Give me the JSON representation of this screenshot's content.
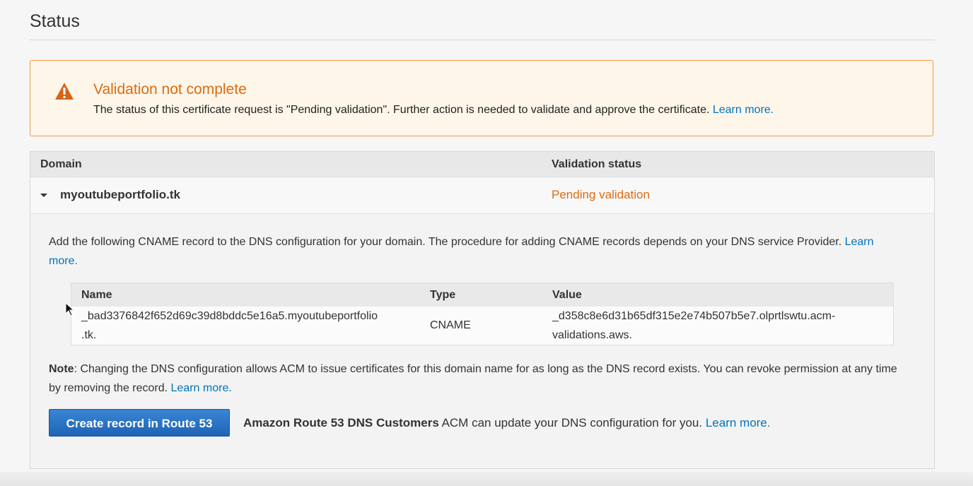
{
  "section": {
    "title": "Status"
  },
  "alert": {
    "icon": "warning-icon",
    "title": "Validation not complete",
    "body": "The status of this certificate request is \"Pending validation\". Further action is needed to validate and approve the certificate.",
    "link": "Learn more.",
    "accent_color": "#dd6b10"
  },
  "domains": {
    "headers": {
      "domain": "Domain",
      "status": "Validation status"
    },
    "row": {
      "domain": "myoutubeportfolio.tk",
      "status": "Pending validation"
    }
  },
  "instructions": {
    "text": "Add the following CNAME record to the DNS configuration for your domain. The procedure for adding CNAME records depends on your DNS service Provider.",
    "link": "Learn more."
  },
  "cname": {
    "headers": {
      "name": "Name",
      "type": "Type",
      "value": "Value"
    },
    "row": {
      "name_line1": "_bad3376842f652d69c39d8bddc5e16a5.myoutubeportfolio",
      "name_line2": ".tk.",
      "type": "CNAME",
      "value_line1": "_d358c8e6d31b65df315e2e74b507b5e7.olprtlswtu.acm-",
      "value_line2": "validations.aws."
    }
  },
  "note": {
    "label": "Note",
    "text": ": Changing the DNS configuration allows ACM to issue certificates for this domain name for as long as the DNS record exists. You can revoke permission at any time by removing the record.",
    "link": "Learn more."
  },
  "route53": {
    "button": "Create record in Route 53",
    "bold": "Amazon Route 53 DNS Customers",
    "text": " ACM can update your DNS configuration for you.",
    "link": "Learn more."
  }
}
